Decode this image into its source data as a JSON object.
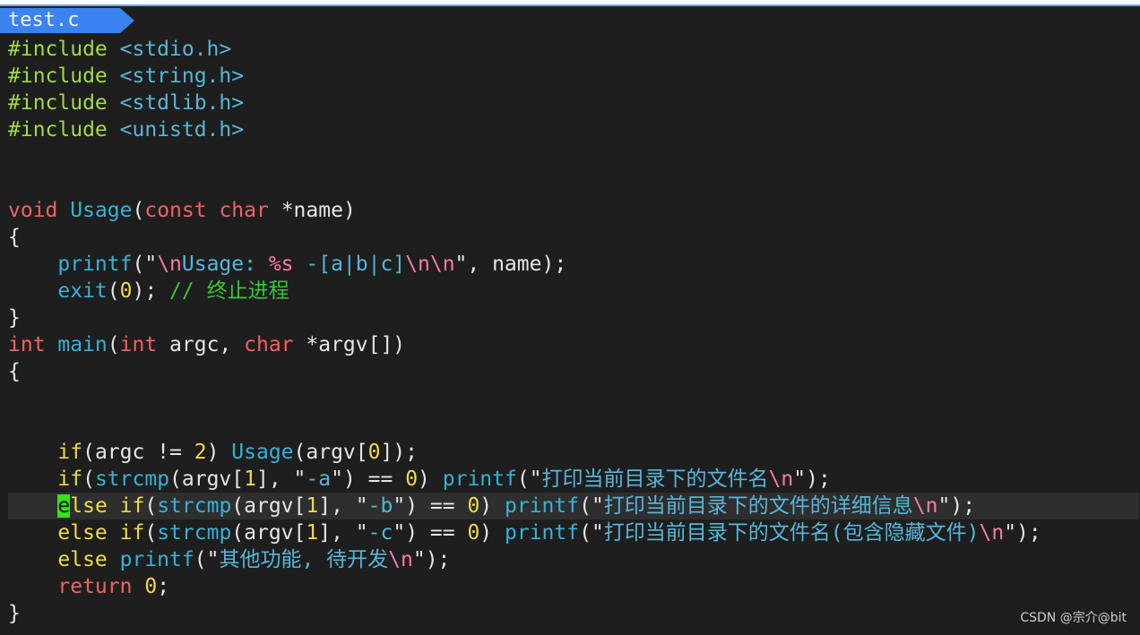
{
  "tab": {
    "filename": "test.c"
  },
  "watermark": "CSDN @宗介@bit",
  "colors": {
    "include": "#9fd94a",
    "header": "#56b6d9",
    "keyword": "#f26163",
    "type": "#f26163",
    "func": "#37b2d6",
    "string": "#f0e7a6",
    "escape": "#f77ba7",
    "number": "#f0d94a",
    "comment": "#36c735",
    "control": "#f0d94a",
    "text": "#e6e6e6",
    "cursor": "#39e01c"
  },
  "code_lines": [
    [
      [
        "#include ",
        "include"
      ],
      [
        "<stdio.h>",
        "header"
      ]
    ],
    [
      [
        "#include ",
        "include"
      ],
      [
        "<string.h>",
        "header"
      ]
    ],
    [
      [
        "#include ",
        "include"
      ],
      [
        "<stdlib.h>",
        "header"
      ]
    ],
    [
      [
        "#include ",
        "include"
      ],
      [
        "<unistd.h>",
        "header"
      ]
    ],
    [],
    [],
    [
      [
        "void ",
        "keyword"
      ],
      [
        "Usage",
        "func"
      ],
      [
        "(",
        "text"
      ],
      [
        "const ",
        "keyword"
      ],
      [
        "char ",
        "keyword"
      ],
      [
        "*name)",
        "text"
      ]
    ],
    [
      [
        "{",
        "text"
      ]
    ],
    [
      [
        "    ",
        "text"
      ],
      [
        "printf",
        "func"
      ],
      [
        "(\"",
        "text"
      ],
      [
        "\\n",
        "escape"
      ],
      [
        "Usage: ",
        "header"
      ],
      [
        "%s",
        "escape"
      ],
      [
        " -[a|b|c]",
        "header"
      ],
      [
        "\\n\\n",
        "escape"
      ],
      [
        "\", name);",
        "text"
      ]
    ],
    [
      [
        "    ",
        "text"
      ],
      [
        "exit",
        "func"
      ],
      [
        "(",
        "text"
      ],
      [
        "0",
        "number"
      ],
      [
        "); ",
        "text"
      ],
      [
        "// 终止进程",
        "comment"
      ]
    ],
    [
      [
        "}",
        "text"
      ]
    ],
    [
      [
        "int ",
        "keyword"
      ],
      [
        "main",
        "func"
      ],
      [
        "(",
        "text"
      ],
      [
        "int ",
        "keyword"
      ],
      [
        "argc, ",
        "text"
      ],
      [
        "char ",
        "keyword"
      ],
      [
        "*argv[])",
        "text"
      ]
    ],
    [
      [
        "{",
        "text"
      ]
    ],
    [],
    [],
    [
      [
        "    ",
        "text"
      ],
      [
        "if",
        "control"
      ],
      [
        "(argc != ",
        "text"
      ],
      [
        "2",
        "number"
      ],
      [
        ") ",
        "text"
      ],
      [
        "Usage",
        "func"
      ],
      [
        "(argv[",
        "text"
      ],
      [
        "0",
        "number"
      ],
      [
        "]);",
        "text"
      ]
    ],
    [
      [
        "    ",
        "text"
      ],
      [
        "if",
        "control"
      ],
      [
        "(",
        "text"
      ],
      [
        "strcmp",
        "func"
      ],
      [
        "(argv[",
        "text"
      ],
      [
        "1",
        "number"
      ],
      [
        "], \"",
        "text"
      ],
      [
        "-a",
        "header"
      ],
      [
        "\") == ",
        "text"
      ],
      [
        "0",
        "number"
      ],
      [
        ") ",
        "text"
      ],
      [
        "printf",
        "func"
      ],
      [
        "(\"",
        "text"
      ],
      [
        "打印当前目录下的文件名",
        "header"
      ],
      [
        "\\n",
        "escape"
      ],
      [
        "\");",
        "text"
      ]
    ],
    [
      [
        "    ",
        "text"
      ],
      [
        "e",
        "cursor"
      ],
      [
        "lse ",
        "control"
      ],
      [
        "if",
        "control"
      ],
      [
        "(",
        "text"
      ],
      [
        "strcmp",
        "func"
      ],
      [
        "(argv[",
        "text"
      ],
      [
        "1",
        "number"
      ],
      [
        "], \"",
        "text"
      ],
      [
        "-b",
        "header"
      ],
      [
        "\") == ",
        "text"
      ],
      [
        "0",
        "number"
      ],
      [
        ") ",
        "text"
      ],
      [
        "printf",
        "func"
      ],
      [
        "(\"",
        "text"
      ],
      [
        "打印当前目录下的文件的详细信息",
        "header"
      ],
      [
        "\\n",
        "escape"
      ],
      [
        "\");",
        "text"
      ]
    ],
    [
      [
        "    ",
        "text"
      ],
      [
        "else ",
        "control"
      ],
      [
        "if",
        "control"
      ],
      [
        "(",
        "text"
      ],
      [
        "strcmp",
        "func"
      ],
      [
        "(argv[",
        "text"
      ],
      [
        "1",
        "number"
      ],
      [
        "], \"",
        "text"
      ],
      [
        "-c",
        "header"
      ],
      [
        "\") == ",
        "text"
      ],
      [
        "0",
        "number"
      ],
      [
        ") ",
        "text"
      ],
      [
        "printf",
        "func"
      ],
      [
        "(\"",
        "text"
      ],
      [
        "打印当前目录下的文件名(包含隐藏文件)",
        "header"
      ],
      [
        "\\n",
        "escape"
      ],
      [
        "\");",
        "text"
      ]
    ],
    [
      [
        "    ",
        "text"
      ],
      [
        "else ",
        "control"
      ],
      [
        "printf",
        "func"
      ],
      [
        "(\"",
        "text"
      ],
      [
        "其他功能, 待开发",
        "header"
      ],
      [
        "\\n",
        "escape"
      ],
      [
        "\");",
        "text"
      ]
    ],
    [
      [
        "    ",
        "text"
      ],
      [
        "return ",
        "keyword"
      ],
      [
        "0",
        "number"
      ],
      [
        ";",
        "text"
      ]
    ],
    [
      [
        "}",
        "text"
      ]
    ]
  ],
  "current_line": 17
}
